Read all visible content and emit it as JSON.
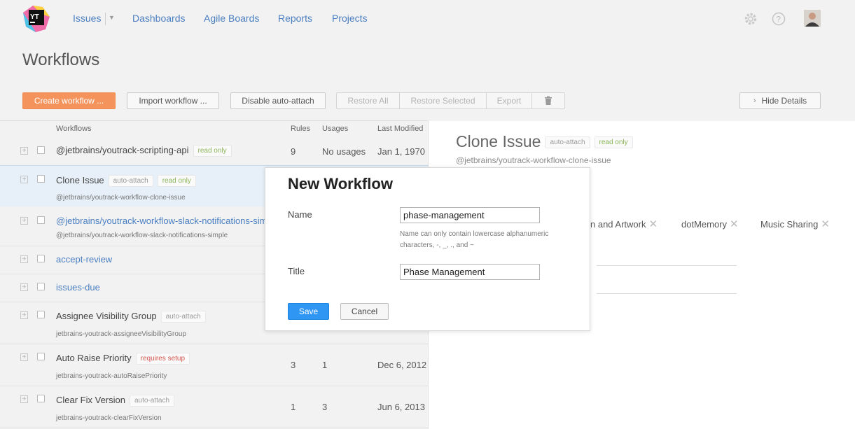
{
  "header": {
    "logo_text": "YT",
    "nav": [
      {
        "label": "Issues"
      },
      {
        "label": "Dashboards"
      },
      {
        "label": "Agile Boards"
      },
      {
        "label": "Reports"
      },
      {
        "label": "Projects"
      }
    ],
    "icons": [
      "settings-icon",
      "help-icon",
      "user-avatar"
    ]
  },
  "page": {
    "title": "Workflows"
  },
  "toolbar": {
    "create": "Create workflow ...",
    "import": "Import workflow ...",
    "disable": "Disable auto-attach",
    "restore_all": "Restore All",
    "restore_selected": "Restore Selected",
    "export": "Export",
    "delete_icon": "trash-icon",
    "hide_details": "Hide Details"
  },
  "list": {
    "columns": [
      "Workflows",
      "Rules",
      "Usages",
      "Last Modified"
    ],
    "rows": [
      {
        "name": "@jetbrains/youtrack-scripting-api",
        "tags": [
          "read only"
        ],
        "sub": "",
        "rules": "9",
        "usages": "No usages",
        "modified": "Jan 1, 1970"
      },
      {
        "name": "Clone Issue",
        "tags": [
          "auto-attach",
          "read only"
        ],
        "sub": "@jetbrains/youtrack-workflow-clone-issue",
        "rules": "",
        "usages": "",
        "modified": ""
      },
      {
        "name": "@jetbrains/youtrack-workflow-slack-notifications-simple",
        "tags": [],
        "sub": "@jetbrains/youtrack-workflow-slack-notifications-simple",
        "rules": "",
        "usages": "",
        "modified": ""
      },
      {
        "name": "accept-review",
        "tags": [],
        "sub": "",
        "rules": "",
        "usages": "",
        "modified": ""
      },
      {
        "name": "issues-due",
        "tags": [],
        "sub": "",
        "rules": "",
        "usages": "",
        "modified": ""
      },
      {
        "name": "Assignee Visibility Group",
        "tags": [
          "auto-attach"
        ],
        "sub": "jetbrains-youtrack-assigneeVisibilityGroup",
        "rules": "",
        "usages": "",
        "modified": ""
      },
      {
        "name": "Auto Raise Priority",
        "tags": [
          "requires setup"
        ],
        "sub": "jetbrains-youtrack-autoRaisePriority",
        "rules": "3",
        "usages": "1",
        "modified": "Dec 6, 2012"
      },
      {
        "name": "Clear Fix Version",
        "tags": [
          "auto-attach"
        ],
        "sub": "jetbrains-youtrack-clearFixVersion",
        "rules": "1",
        "usages": "3",
        "modified": "Jun 6, 2013"
      }
    ]
  },
  "details": {
    "title": "Clone Issue",
    "tags": [
      "auto-attach",
      "read only"
    ],
    "subtitle": "@jetbrains/youtrack-workflow-clone-issue",
    "projects": [
      "n and Artwork",
      "dotMemory",
      "Music Sharing"
    ]
  },
  "dialog": {
    "title": "New Workflow",
    "name_label": "Name",
    "name_value": "phase-management",
    "name_hint": "Name can only contain lowercase alphanumeric characters, -, _, ., and ~",
    "title_label": "Title",
    "title_value": "Phase Management",
    "save": "Save",
    "cancel": "Cancel"
  },
  "colors": {
    "accent": "#f4935b",
    "link": "#4a7fc1",
    "save": "#2f96f3",
    "read_only": "#8cb55a",
    "requires_setup": "#d2554c"
  }
}
